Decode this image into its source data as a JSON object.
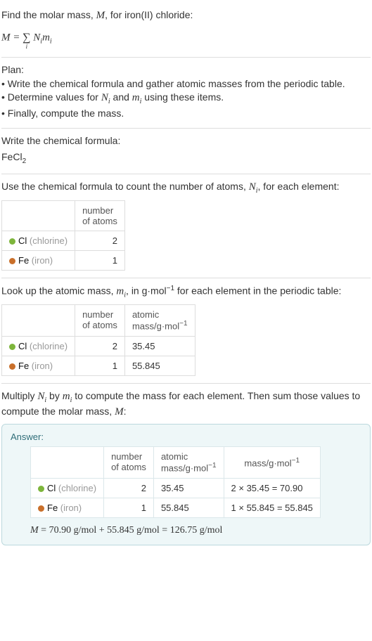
{
  "intro": {
    "line1_a": "Find the molar mass, ",
    "line1_M": "M",
    "line1_b": ", for iron(II) chloride:",
    "eq_left": "M",
    "eq_eq": " = ",
    "eq_Ni": "N",
    "eq_i1": "i",
    "eq_mi": "m",
    "eq_i2": "i",
    "sigma_bot": "i"
  },
  "plan": {
    "heading": "Plan:",
    "b1_a": "• Write the chemical formula and gather atomic masses from the periodic table.",
    "b2_a": "• Determine values for ",
    "b2_Ni_N": "N",
    "b2_Ni_i": "i",
    "b2_mid": " and ",
    "b2_mi_m": "m",
    "b2_mi_i": "i",
    "b2_b": " using these items.",
    "b3": "• Finally, compute the mass."
  },
  "formula_sec": {
    "heading": "Write the chemical formula:",
    "f1": "FeCl",
    "f1_sub": "2"
  },
  "count_sec": {
    "heading_a": "Use the chemical formula to count the number of atoms, ",
    "heading_Ni_N": "N",
    "heading_Ni_i": "i",
    "heading_b": ", for each element:",
    "th_atoms_l1": "number",
    "th_atoms_l2": "of atoms",
    "cl_sym": "Cl",
    "cl_name": " (chlorine)",
    "cl_n": "2",
    "fe_sym": "Fe",
    "fe_name": " (iron)",
    "fe_n": "1"
  },
  "mass_sec": {
    "heading_a": "Look up the atomic mass, ",
    "heading_mi_m": "m",
    "heading_mi_i": "i",
    "heading_b": ", in g·mol",
    "heading_exp": "−1",
    "heading_c": " for each element in the periodic table:",
    "th_atoms_l1": "number",
    "th_atoms_l2": "of atoms",
    "th_mass_l1": "atomic",
    "th_mass_l2a": "mass/g·mol",
    "th_mass_exp": "−1",
    "cl_n": "2",
    "cl_m": "35.45",
    "fe_n": "1",
    "fe_m": "55.845"
  },
  "mult_sec": {
    "heading_a": "Multiply ",
    "Ni_N": "N",
    "Ni_i": "i",
    "heading_b": " by ",
    "mi_m": "m",
    "mi_i": "i",
    "heading_c": " to compute the mass for each element. Then sum those values to compute the molar mass, ",
    "M": "M",
    "heading_d": ":"
  },
  "answer": {
    "label": "Answer:",
    "th_atoms_l1": "number",
    "th_atoms_l2": "of atoms",
    "th_amass_l1": "atomic",
    "th_amass_l2a": "mass/g·mol",
    "th_amass_exp": "−1",
    "th_mass_a": "mass/g·mol",
    "th_mass_exp": "−1",
    "cl_n": "2",
    "cl_am": "35.45",
    "cl_calc": "2 × 35.45 = 70.90",
    "fe_n": "1",
    "fe_am": "55.845",
    "fe_calc": "1 × 55.845 = 55.845",
    "final_M": "M",
    "final_rest": " = 70.90 g/mol + 55.845 g/mol = 126.75 g/mol"
  },
  "chart_data": {
    "type": "table",
    "title": "Molar mass of iron(II) chloride (FeCl2)",
    "columns": [
      "element",
      "number_of_atoms",
      "atomic_mass_g_per_mol",
      "mass_g_per_mol"
    ],
    "rows": [
      {
        "element": "Cl (chlorine)",
        "number_of_atoms": 2,
        "atomic_mass_g_per_mol": 35.45,
        "mass_g_per_mol": 70.9
      },
      {
        "element": "Fe (iron)",
        "number_of_atoms": 1,
        "atomic_mass_g_per_mol": 55.845,
        "mass_g_per_mol": 55.845
      }
    ],
    "molar_mass_g_per_mol": 126.75
  }
}
